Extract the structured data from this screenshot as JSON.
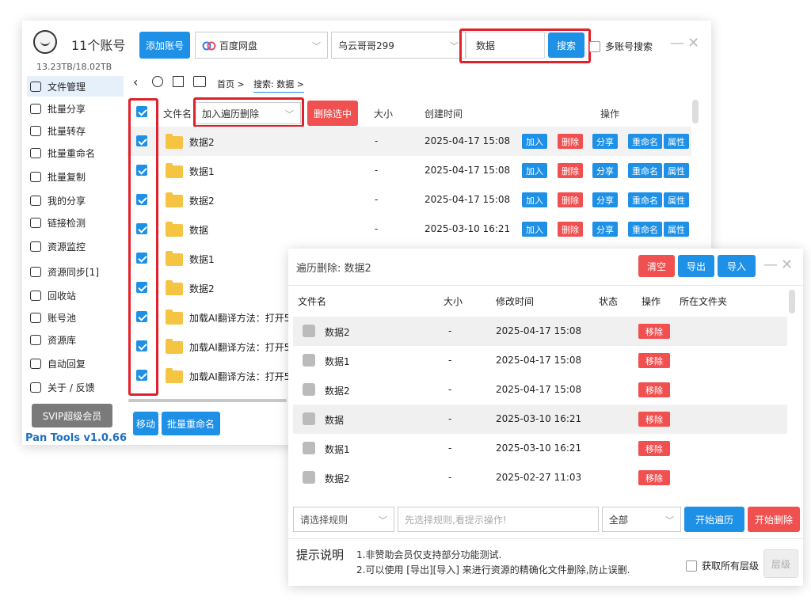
{
  "header": {
    "account_count": "11个账号",
    "storage": "13.23TB/18.02TB",
    "add_account": "添加账号",
    "drive": "百度网盘",
    "user": "乌云哥哥299",
    "search_value": "数据",
    "search_button": "搜索",
    "multi_search": "多账号搜索"
  },
  "sidebar": {
    "items": [
      {
        "label": "文件管理"
      },
      {
        "label": "批量分享"
      },
      {
        "label": "批量转存"
      },
      {
        "label": "批量重命名"
      },
      {
        "label": "批量复制"
      },
      {
        "label": "我的分享"
      },
      {
        "label": "链接检测"
      },
      {
        "label": "资源监控"
      },
      {
        "label": "资源同步[1]"
      },
      {
        "label": "回收站"
      },
      {
        "label": "账号池"
      },
      {
        "label": "资源库"
      },
      {
        "label": "自动回复"
      },
      {
        "label": "关于 / 反馈"
      }
    ],
    "svip": "SVIP超级会员",
    "version": "Pan Tools v1.0.66"
  },
  "breadcrumb": {
    "home": "首页 >",
    "current": "搜索: 数据 >"
  },
  "table": {
    "col_name": "文件名",
    "traverse_select": "加入遍历删除",
    "delete_selected": "删除选中",
    "col_size": "大小",
    "col_created": "创建时间",
    "col_ops": "操作",
    "ops": {
      "add": "加入",
      "delete": "删除",
      "share": "分享",
      "rename": "重命名",
      "props": "属性"
    },
    "rows": [
      {
        "name": "数据2",
        "size": "-",
        "created": "2025-04-17 15:08",
        "ops": true
      },
      {
        "name": "数据1",
        "size": "-",
        "created": "2025-04-17 15:08",
        "ops": true
      },
      {
        "name": "数据2",
        "size": "-",
        "created": "2025-04-17 15:08",
        "ops": true
      },
      {
        "name": "数据",
        "size": "-",
        "created": "2025-03-10 16:21",
        "ops": true
      },
      {
        "name": "数据1",
        "size": "",
        "created": "",
        "ops": false
      },
      {
        "name": "数据2",
        "size": "",
        "created": "",
        "ops": false
      },
      {
        "name": "加载AI翻译方法：打开5",
        "size": "",
        "created": "",
        "ops": false
      },
      {
        "name": "加载AI翻译方法：打开5",
        "size": "",
        "created": "",
        "ops": false
      },
      {
        "name": "加载AI翻译方法：打开5",
        "size": "",
        "created": "",
        "ops": false
      }
    ],
    "move": "移动",
    "batch_rename": "批量重命名"
  },
  "dialog": {
    "title": "遍历删除: 数据2",
    "clear": "清空",
    "export": "导出",
    "import": "导入",
    "col_name": "文件名",
    "col_size": "大小",
    "col_modified": "修改时间",
    "col_status": "状态",
    "col_ops": "操作",
    "col_folder": "所在文件夹",
    "remove": "移除",
    "rows": [
      {
        "name": "数据2",
        "size": "-",
        "modified": "2025-04-17 15:08"
      },
      {
        "name": "数据1",
        "size": "-",
        "modified": "2025-04-17 15:08"
      },
      {
        "name": "数据2",
        "size": "-",
        "modified": "2025-04-17 15:08"
      },
      {
        "name": "数据",
        "size": "-",
        "modified": "2025-03-10 16:21"
      },
      {
        "name": "数据1",
        "size": "-",
        "modified": "2025-03-10 16:21"
      },
      {
        "name": "数据2",
        "size": "-",
        "modified": "2025-02-27 11:03"
      }
    ],
    "rule_placeholder": "请选择规则",
    "hint_placeholder": "先选择规则,看提示操作!",
    "scope": "全部",
    "start_traverse": "开始遍历",
    "start_delete": "开始删除",
    "tips_label": "提示说明",
    "tip1": "1.非赞助会员仅支持部分功能测试.",
    "tip2": "2.可以使用 [导出][导入] 来进行资源的精确化文件删除,防止误删.",
    "get_all_levels": "获取所有层级",
    "level": "层级"
  },
  "colors": {
    "accent": "#1e90e6",
    "danger": "#f05050",
    "highlight": "#e0202a"
  }
}
